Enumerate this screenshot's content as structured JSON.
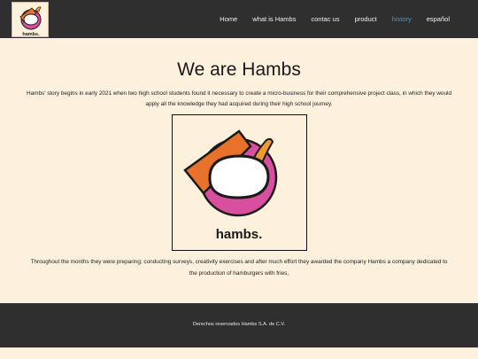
{
  "nav": {
    "items": [
      "Home",
      "what is Hambs",
      "contac us",
      "product",
      "history",
      "español"
    ],
    "active": "history"
  },
  "logo": {
    "text": "hambs."
  },
  "main": {
    "title": "We are Hambs",
    "intro": "Hambs' story begins in early 2021 when two high school students found it necessary to create a micro-business for their comprehensive project class, in which they would apply all the knowledge they had acquired during their high school journey.",
    "figure_label": "hambs.",
    "outro": "Throughout the months they were preparing; conducting surveys, creativity exercises and after much effort they awarded the company Hambs a company dedicated to the production of hamburgers with fries,"
  },
  "footer": {
    "text": "Derechos reservados Hambs S.A. de C.V."
  },
  "colors": {
    "navbar": "#2f2f2f",
    "page_bg": "#fdf0dc",
    "active_link": "#4a90d9",
    "brand_pink": "#d94fa0",
    "brand_orange": "#e8722a",
    "fries_orange": "#f09a2a"
  }
}
